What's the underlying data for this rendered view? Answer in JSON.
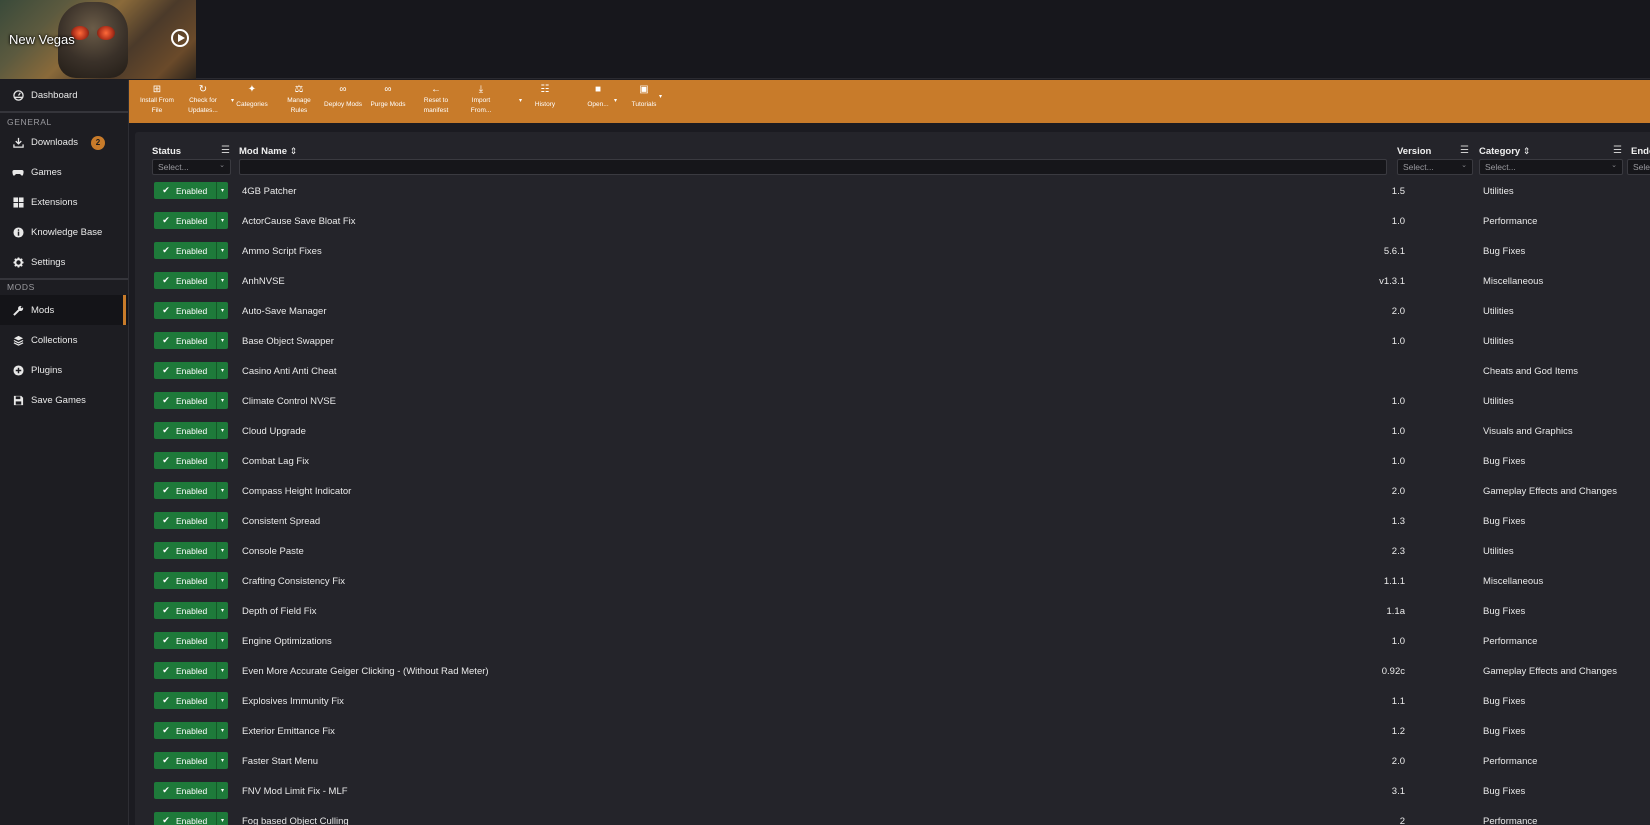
{
  "game": {
    "title": "New Vegas"
  },
  "sidebar": {
    "top": [
      {
        "label": "Dashboard",
        "icon": "dashboard-icon"
      }
    ],
    "sections": [
      {
        "title": "GENERAL",
        "items": [
          {
            "label": "Downloads",
            "icon": "download-icon",
            "badge": "2"
          },
          {
            "label": "Games",
            "icon": "gamepad-icon"
          },
          {
            "label": "Extensions",
            "icon": "grid-icon"
          },
          {
            "label": "Knowledge Base",
            "icon": "info-icon"
          },
          {
            "label": "Settings",
            "icon": "gear-icon"
          }
        ]
      },
      {
        "title": "MODS",
        "items": [
          {
            "label": "Mods",
            "icon": "wrench-icon",
            "active": true
          },
          {
            "label": "Collections",
            "icon": "layers-icon"
          },
          {
            "label": "Plugins",
            "icon": "plus-circle-icon"
          },
          {
            "label": "Save Games",
            "icon": "floppy-icon"
          }
        ]
      }
    ]
  },
  "toolbar": {
    "install_from_file": [
      "Install From",
      "File"
    ],
    "check_for_updates": [
      "Check for",
      "Updates..."
    ],
    "categories": "Categories",
    "manage_rules": [
      "Manage",
      "Rules"
    ],
    "deploy_mods": "Deploy Mods",
    "purge_mods": "Purge Mods",
    "reset_to_manifest": [
      "Reset to",
      "manifest"
    ],
    "import_from": [
      "Import",
      "From..."
    ],
    "history": "History",
    "open": "Open...",
    "tutorials": "Tutorials"
  },
  "table": {
    "headers": {
      "status": "Status",
      "mod_name": "Mod Name",
      "version": "Version",
      "category": "Category",
      "endorsed": "Endo"
    },
    "filters": {
      "status_placeholder": "Select...",
      "version_placeholder": "Select...",
      "category_placeholder": "Select...",
      "endorsed_placeholder": "Sele"
    },
    "status_label": "Enabled",
    "rows": [
      {
        "name": "4GB Patcher",
        "version": "1.5",
        "category": "Utilities"
      },
      {
        "name": "ActorCause Save Bloat Fix",
        "version": "1.0",
        "category": "Performance"
      },
      {
        "name": "Ammo Script Fixes",
        "version": "5.6.1",
        "category": "Bug Fixes"
      },
      {
        "name": "AnhNVSE",
        "version": "v1.3.1",
        "category": "Miscellaneous"
      },
      {
        "name": "Auto-Save Manager",
        "version": "2.0",
        "category": "Utilities"
      },
      {
        "name": "Base Object Swapper",
        "version": "1.0",
        "category": "Utilities"
      },
      {
        "name": "Casino Anti Anti Cheat",
        "version": "",
        "category": "Cheats and God Items"
      },
      {
        "name": "Climate Control NVSE",
        "version": "1.0",
        "category": "Utilities"
      },
      {
        "name": "Cloud Upgrade",
        "version": "1.0",
        "category": "Visuals and Graphics"
      },
      {
        "name": "Combat Lag Fix",
        "version": "1.0",
        "category": "Bug Fixes"
      },
      {
        "name": "Compass Height Indicator",
        "version": "2.0",
        "category": "Gameplay Effects and Changes"
      },
      {
        "name": "Consistent Spread",
        "version": "1.3",
        "category": "Bug Fixes"
      },
      {
        "name": "Console Paste",
        "version": "2.3",
        "category": "Utilities"
      },
      {
        "name": "Crafting Consistency Fix",
        "version": "1.1.1",
        "category": "Miscellaneous"
      },
      {
        "name": "Depth of Field Fix",
        "version": "1.1a",
        "category": "Bug Fixes"
      },
      {
        "name": "Engine Optimizations",
        "version": "1.0",
        "category": "Performance"
      },
      {
        "name": "Even More Accurate Geiger Clicking - (Without Rad Meter)",
        "version": "0.92c",
        "category": "Gameplay Effects and Changes"
      },
      {
        "name": "Explosives Immunity Fix",
        "version": "1.1",
        "category": "Bug Fixes"
      },
      {
        "name": "Exterior Emittance Fix",
        "version": "1.2",
        "category": "Bug Fixes"
      },
      {
        "name": "Faster Start Menu",
        "version": "2.0",
        "category": "Performance"
      },
      {
        "name": "FNV Mod Limit Fix - MLF",
        "version": "3.1",
        "category": "Bug Fixes"
      },
      {
        "name": "Fog based Object Culling",
        "version": "2",
        "category": "Performance"
      }
    ]
  }
}
